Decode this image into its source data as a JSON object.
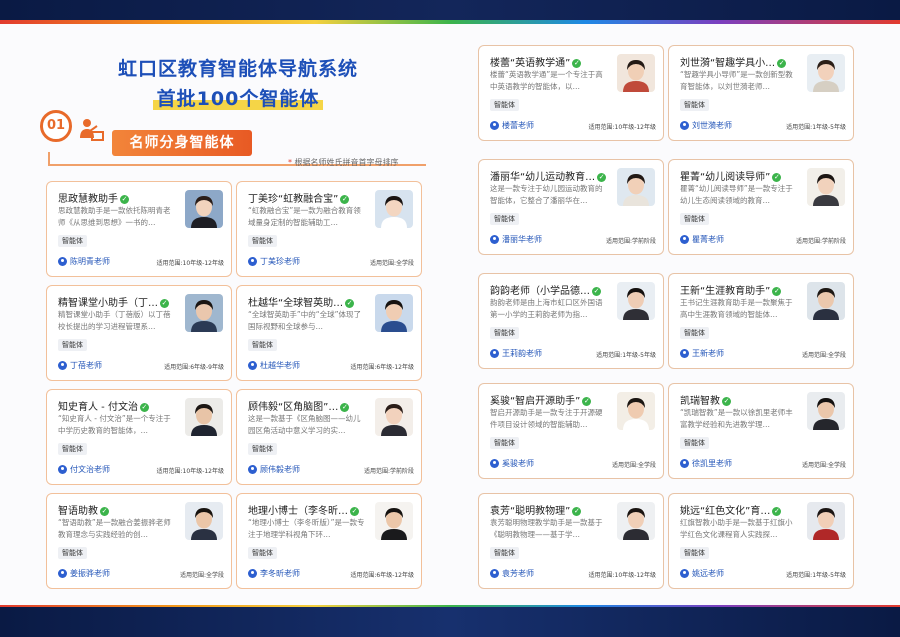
{
  "header": {
    "title_line1": "虹口区教育智能体导航系统",
    "title_line2": "首批100个智能体"
  },
  "section": {
    "number": "01",
    "icon": "teacher-podium-icon",
    "title": "名师分身智能体",
    "note_star": "*",
    "note": "根据名师姓氏拼音首字母排序"
  },
  "cards_left": [
    {
      "name": "思政慧教助手",
      "desc": "思政慧教助手是一款依托陈明青老师《从思维到思想》一书的…",
      "tag": "智能体",
      "author": "陈明青老师",
      "range": "适用范围:10年级-12年级",
      "avatar_bg": "#8da8c8",
      "hair": "#2a1e1a",
      "skin": "#f1d3bd",
      "cloth": "#1e1e24"
    },
    {
      "name": "丁美珍“虹教融合宝”",
      "desc": "“虹教融合宝”是一款为融合教育领域量身定制的智能辅助工…",
      "tag": "智能体",
      "author": "丁美珍老师",
      "range": "适用范围:全学段",
      "avatar_bg": "#d7e3ef",
      "hair": "#1a1412",
      "skin": "#f3d6c1",
      "cloth": "#ffffff"
    },
    {
      "name": "精智课堂小助手（丁…",
      "desc": "精智课堂小助手（丁蓓版）以丁蓓校长提出的学习进程管理系…",
      "tag": "智能体",
      "author": "丁蓓老师",
      "range": "适用范围:6年级-9年级",
      "avatar_bg": "#9fb7cf",
      "hair": "#1b1512",
      "skin": "#eac7ad",
      "cloth": "#2b3a55"
    },
    {
      "name": "杜越华“全球智英助…",
      "desc": "“全球智英助手”中的“全球”体现了国际视野和全球参与…",
      "tag": "智能体",
      "author": "杜越华老师",
      "range": "适用范围:6年级-12年级",
      "avatar_bg": "#c9d9ec",
      "hair": "#17120f",
      "skin": "#f0cdb3",
      "cloth": "#2a4d8f"
    },
    {
      "name": "知史育人 - 付文治",
      "desc": "“知史育人 - 付文治”是一个专注于中学历史教育的智能体，…",
      "tag": "智能体",
      "author": "付文治老师",
      "range": "适用范围:10年级-12年级",
      "avatar_bg": "#ecebe8",
      "hair": "#1c1714",
      "skin": "#e8c4a7",
      "cloth": "#1f2430"
    },
    {
      "name": "顾伟毅“区角脑图”…",
      "desc": "这是一款基于《区角脑图——幼儿园区角活动中意义学习的实…",
      "tag": "智能体",
      "author": "顾伟毅老师",
      "range": "适用范围:学前阶段",
      "avatar_bg": "#f3eee9",
      "hair": "#2a1d18",
      "skin": "#f2d2bd",
      "cloth": "#2b2b33"
    },
    {
      "name": "智语助教",
      "desc": "“智语助教”是一款融合姜振骅老师教育理念与实践经验的创…",
      "tag": "智能体",
      "author": "姜振骅老师",
      "range": "适用范围:全学段",
      "avatar_bg": "#e6ebf1",
      "hair": "#18130f",
      "skin": "#ebc6a8",
      "cloth": "#2a3142"
    },
    {
      "name": "地理小博士（李冬昕…",
      "desc": "“地理小博士（李冬昕版）”是一款专注于地理学科视角下环…",
      "tag": "智能体",
      "author": "李冬昕老师",
      "range": "适用范围:6年级-12年级",
      "avatar_bg": "#f5f3f0",
      "hair": "#151210",
      "skin": "#ecc7a9",
      "cloth": "#1a1a1c"
    }
  ],
  "cards_right": [
    {
      "name": "楼蕾“英语教学通”",
      "desc": "楼蕾“英语教学通”是一个专注于高中英语教学的智能体，以…",
      "tag": "智能体",
      "author": "楼蕾老师",
      "range": "适用范围:10年级-12年级",
      "avatar_bg": "#f1e6dc",
      "hair": "#231a15",
      "skin": "#f0cfb6",
      "cloth": "#c04a3a"
    },
    {
      "name": "刘世漪“智趣学具小…",
      "desc": "“智趣学具小导师”是一款创新型教育智能体，以刘世漪老师…",
      "tag": "智能体",
      "author": "刘世漪老师",
      "range": "适用范围:1年级-5年级",
      "avatar_bg": "#e8eef3",
      "hair": "#2b1f18",
      "skin": "#f2d1bb",
      "cloth": "#d6cfc3"
    },
    {
      "name": "潘丽华“幼儿运动教育…",
      "desc": "这是一款专注于幼儿园运动教育的智能体，它整合了潘丽华在…",
      "tag": "智能体",
      "author": "潘丽华老师",
      "range": "适用范围:学前阶段",
      "avatar_bg": "#dfe8f0",
      "hair": "#211915",
      "skin": "#f1d0b8",
      "cloth": "#e9e4dc"
    },
    {
      "name": "瞿菁“幼儿阅读导师”",
      "desc": "瞿菁“幼儿阅读导师”是一款专注于幼儿生态阅读领域的教育…",
      "tag": "智能体",
      "author": "瞿菁老师",
      "range": "适用范围:学前阶段",
      "avatar_bg": "#f2efe9",
      "hair": "#1c1613",
      "skin": "#f1d2bc",
      "cloth": "#3a3a40"
    },
    {
      "name": "韵韵老师（小学品德…",
      "desc": "韵韵老师是由上海市虹口区外国语第一小学的王莉韵老师为指…",
      "tag": "智能体",
      "author": "王莉韵老师",
      "range": "适用范围:1年级-5年级",
      "avatar_bg": "#e9eef3",
      "hair": "#15110f",
      "skin": "#efcdb5",
      "cloth": "#2f2f36"
    },
    {
      "name": "王新“生涯教育助手”",
      "desc": "王书记生涯教育助手是一款聚焦于高中生涯教育领域的智能体…",
      "tag": "智能体",
      "author": "王新老师",
      "range": "适用范围:全学段",
      "avatar_bg": "#dde4ea",
      "hair": "#1e1814",
      "skin": "#ebc8ad",
      "cloth": "#2a3040"
    },
    {
      "name": "奚骏“智启开源助手”",
      "desc": "智启开源助手是一款专注于开源硬件项目设计领域的智能辅助…",
      "tag": "智能体",
      "author": "奚骏老师",
      "range": "适用范围:全学段",
      "avatar_bg": "#f3eee6",
      "hair": "#1b1612",
      "skin": "#efcbb0",
      "cloth": "#ffffff"
    },
    {
      "name": "凯瑞智教",
      "desc": "“凯瑞智教”是一款以徐凯里老师丰富教学经验和先进教学理…",
      "tag": "智能体",
      "author": "徐凯里老师",
      "range": "适用范围:全学段",
      "avatar_bg": "#e9ecef",
      "hair": "#141110",
      "skin": "#ebc7ab",
      "cloth": "#25262c"
    },
    {
      "name": "袁芳“聪明教物理”",
      "desc": "袁芳聪明物理教学助手是一款基于《聪明教物理——基于学…",
      "tag": "智能体",
      "author": "袁芳老师",
      "range": "适用范围:10年级-12年级",
      "avatar_bg": "#eef0f2",
      "hair": "#1a1411",
      "skin": "#f0cfb7",
      "cloth": "#2c2c33"
    },
    {
      "name": "姚远“红色文化”育…",
      "desc": "红旗智教小助手是一款基于红旗小学红色文化课程育人实践探…",
      "tag": "智能体",
      "author": "姚远老师",
      "range": "适用范围:1年级-5年级",
      "avatar_bg": "#e6e9ee",
      "hair": "#1b1513",
      "skin": "#f1cfb7",
      "cloth": "#b02828"
    }
  ]
}
